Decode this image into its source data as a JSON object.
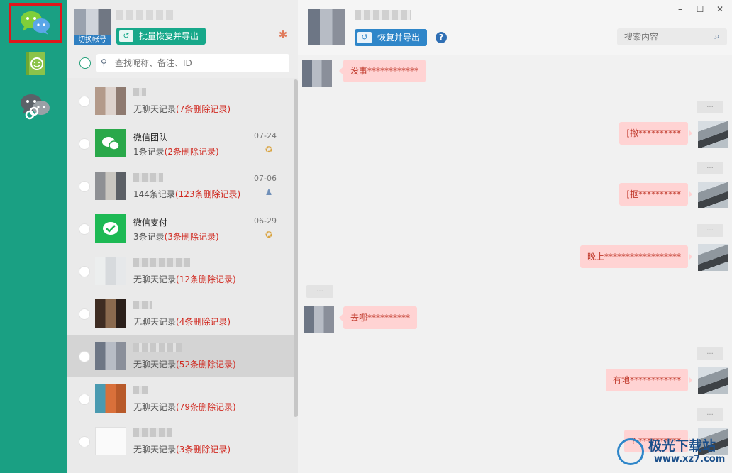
{
  "rail": {
    "items": [
      {
        "name": "wechat",
        "active": true
      },
      {
        "name": "contacts-book",
        "active": false
      },
      {
        "name": "linked-chats",
        "active": false
      }
    ]
  },
  "account": {
    "switch_label": "切换帐号",
    "bulk_restore_label": "批量恢复并导出"
  },
  "search": {
    "placeholder": "查找昵称、备注、ID"
  },
  "conversations": [
    {
      "name": "",
      "sub": "无聊天记录",
      "del": "(7条删除记录)",
      "date": "",
      "marker": ""
    },
    {
      "name": "微信团队",
      "sub": "1条记录",
      "del": "(2条删除记录)",
      "date": "07-24",
      "marker": "badge"
    },
    {
      "name": "",
      "sub": "144条记录",
      "del": "(123条删除记录)",
      "date": "07-06",
      "marker": "person"
    },
    {
      "name": "微信支付",
      "sub": "3条记录",
      "del": "(3条删除记录)",
      "date": "06-29",
      "marker": "badge"
    },
    {
      "name": "",
      "sub": "无聊天记录",
      "del": "(12条删除记录)",
      "date": "",
      "marker": ""
    },
    {
      "name": "",
      "sub": "无聊天记录",
      "del": "(4条删除记录)",
      "date": "",
      "marker": ""
    },
    {
      "name": "",
      "sub": "无聊天记录",
      "del": "(52条删除记录)",
      "date": "",
      "marker": "",
      "selected": true
    },
    {
      "name": "",
      "sub": "无聊天记录",
      "del": "(79条删除记录)",
      "date": "",
      "marker": ""
    },
    {
      "name": "",
      "sub": "无聊天记录",
      "del": "(3条删除记录)",
      "date": "",
      "marker": ""
    }
  ],
  "chat": {
    "restore_label": "恢复并导出",
    "help_glyph": "?",
    "search_placeholder": "搜索内容",
    "window": {
      "minimize": "–",
      "maximize": "☐",
      "close": "✕"
    },
    "time_chip": "...",
    "messages": [
      {
        "side": "left",
        "text": "没事************"
      },
      {
        "side": "right",
        "text": "[撤**********"
      },
      {
        "side": "right",
        "text": "[抠**********"
      },
      {
        "side": "right",
        "text": "晚上******************"
      },
      {
        "side": "left",
        "text": "去哪**********"
      },
      {
        "side": "right",
        "text": "有地************"
      },
      {
        "side": "right",
        "text": "? **********"
      }
    ]
  },
  "watermark": {
    "brand": "极光下载站",
    "site": "www.xz7.com"
  },
  "colors": {
    "rail": "#1aa083",
    "accent_green": "#17a88a",
    "accent_blue": "#2f86c9",
    "deleted_red": "#d0281f",
    "bubble": "#ffd3d3"
  }
}
